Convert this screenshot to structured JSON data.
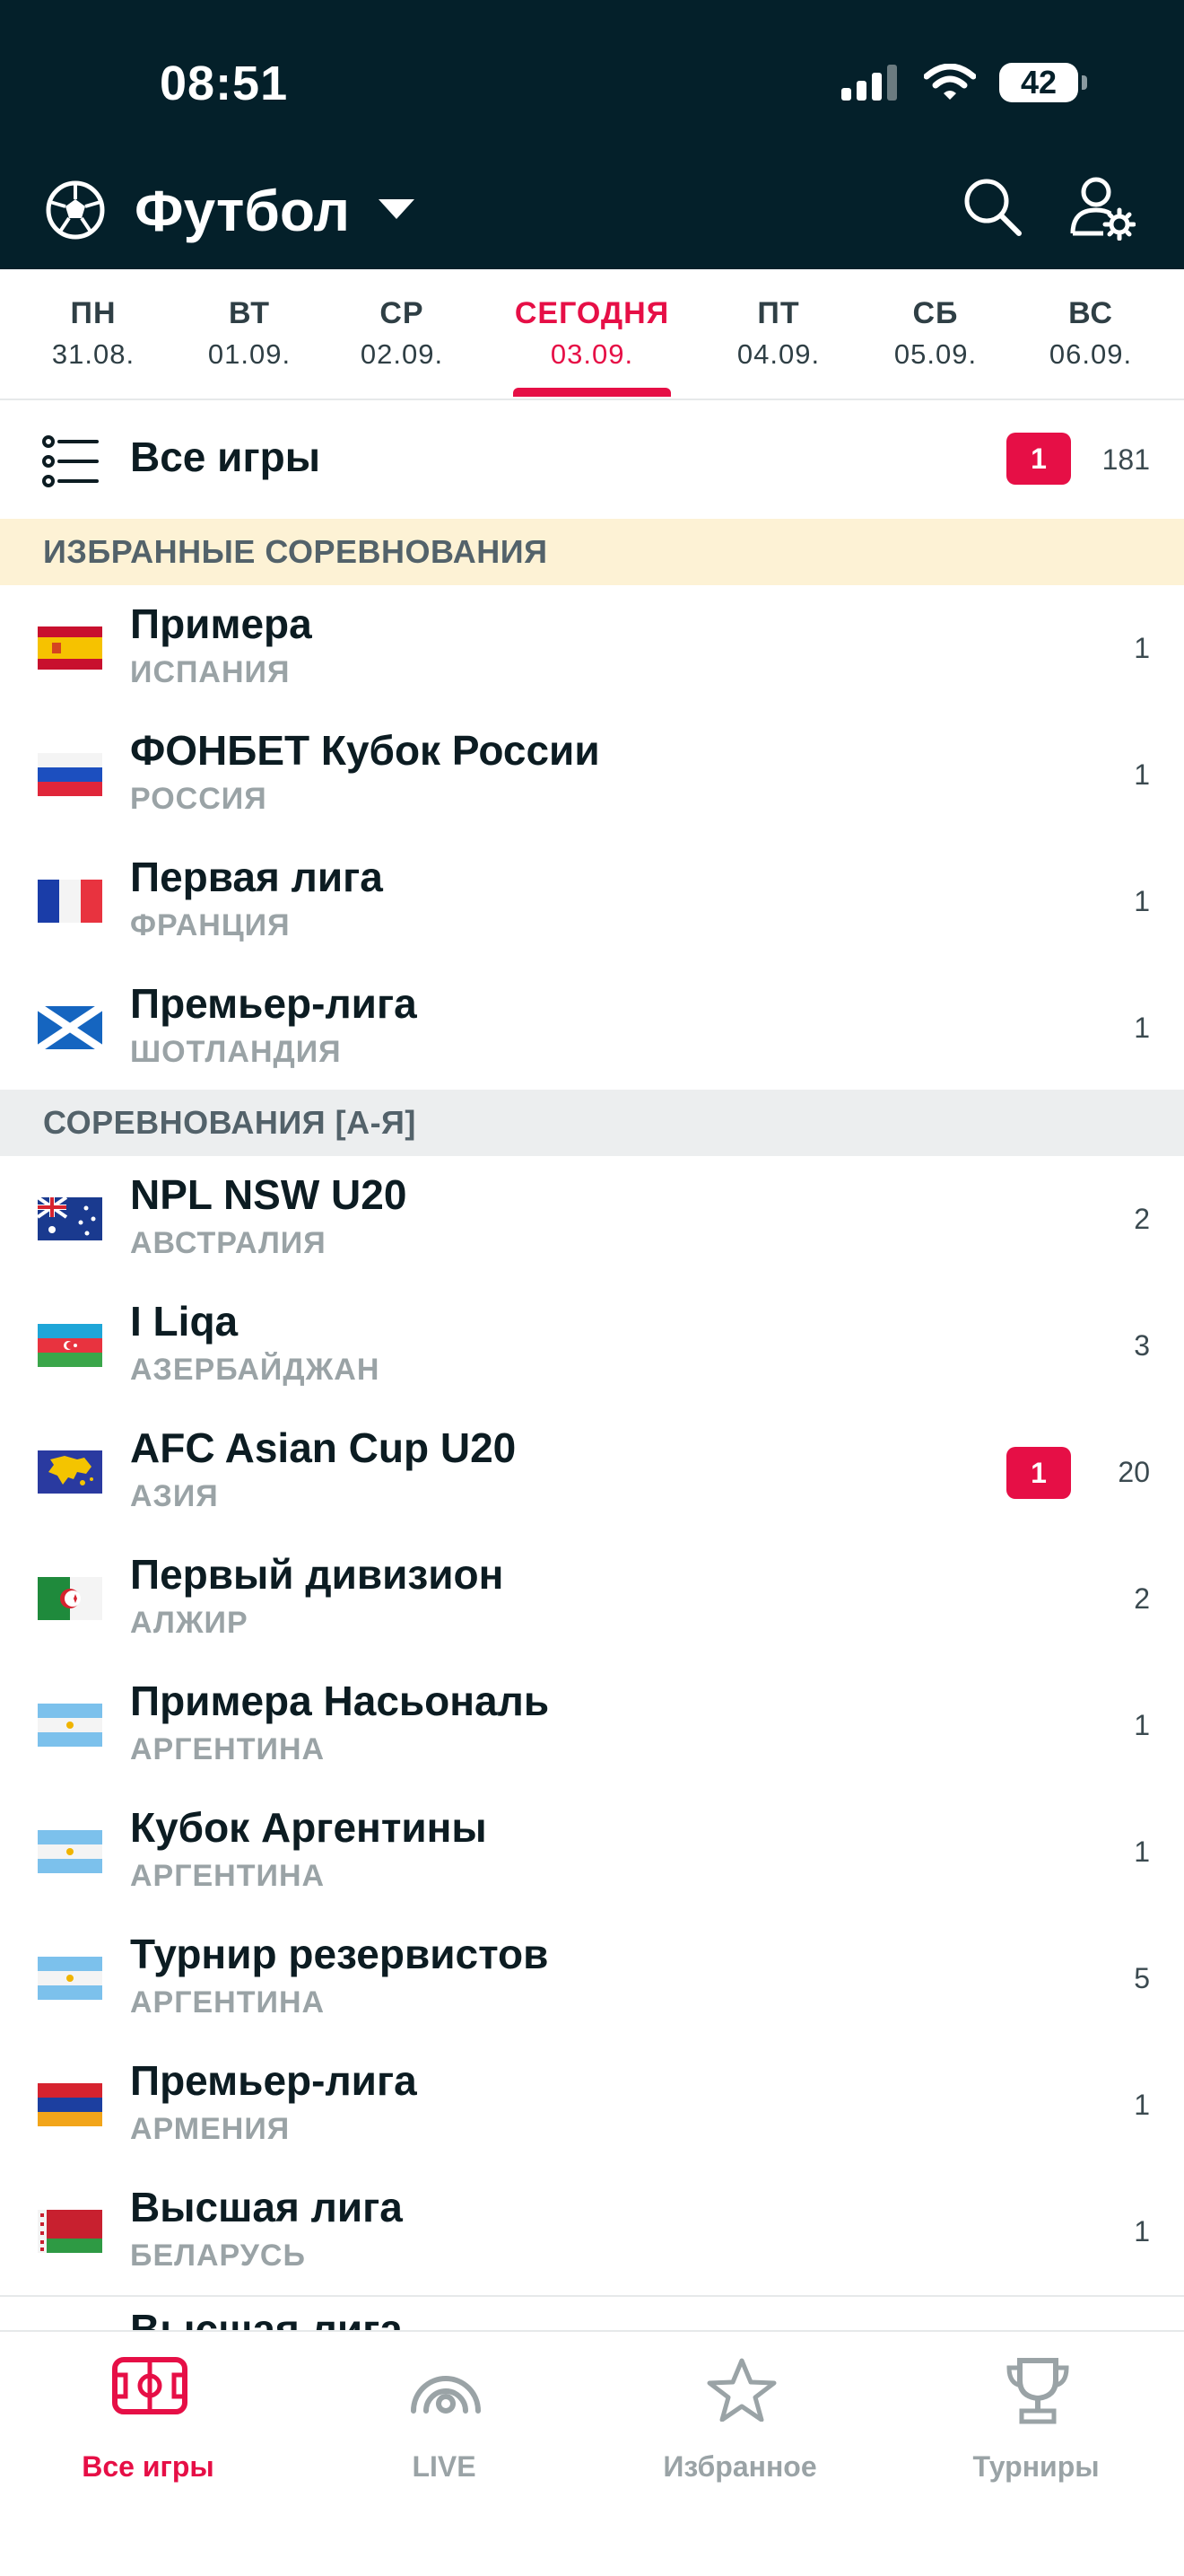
{
  "status_bar": {
    "time": "08:51",
    "battery": "42"
  },
  "app_bar": {
    "sport": "Футбол"
  },
  "days": [
    {
      "dow": "ПН",
      "date": "31.08."
    },
    {
      "dow": "ВТ",
      "date": "01.09."
    },
    {
      "dow": "СР",
      "date": "02.09."
    },
    {
      "dow": "СЕГОДНЯ",
      "date": "03.09.",
      "active": true
    },
    {
      "dow": "ПТ",
      "date": "04.09."
    },
    {
      "dow": "СБ",
      "date": "05.09."
    },
    {
      "dow": "ВС",
      "date": "06.09."
    }
  ],
  "all_games": {
    "label": "Все игры",
    "live": "1",
    "count": "181"
  },
  "sections": {
    "favorites": "ИЗБРАННЫЕ СОРЕВНОВАНИЯ",
    "all": "СОРЕВНОВАНИЯ [А-Я]"
  },
  "favorites": [
    {
      "name": "Примера",
      "country": "ИСПАНИЯ",
      "count": "1",
      "flag": "spain"
    },
    {
      "name": "ФОНБЕТ Кубок России",
      "country": "РОССИЯ",
      "count": "1",
      "flag": "russia"
    },
    {
      "name": "Первая лига",
      "country": "ФРАНЦИЯ",
      "count": "1",
      "flag": "france"
    },
    {
      "name": "Премьер-лига",
      "country": "ШОТЛАНДИЯ",
      "count": "1",
      "flag": "scotland"
    }
  ],
  "competitions": [
    {
      "name": "NPL NSW U20",
      "country": "АВСТРАЛИЯ",
      "count": "2",
      "flag": "australia"
    },
    {
      "name": "I Liqa",
      "country": "АЗЕРБАЙДЖАН",
      "count": "3",
      "flag": "azerbaijan"
    },
    {
      "name": "AFC Asian Cup U20",
      "country": "АЗИЯ",
      "count": "20",
      "live": "1",
      "flag": "asia"
    },
    {
      "name": "Первый дивизион",
      "country": "АЛЖИР",
      "count": "2",
      "flag": "algeria"
    },
    {
      "name": "Примера Насьональ",
      "country": "АРГЕНТИНА",
      "count": "1",
      "flag": "argentina"
    },
    {
      "name": "Кубок Аргентины",
      "country": "АРГЕНТИНА",
      "count": "1",
      "flag": "argentina"
    },
    {
      "name": "Турнир резервистов",
      "country": "АРГЕНТИНА",
      "count": "5",
      "flag": "argentina"
    },
    {
      "name": "Премьер-лига",
      "country": "АРМЕНИЯ",
      "count": "1",
      "flag": "armenia"
    },
    {
      "name": "Высшая лига",
      "country": "БЕЛАРУСЬ",
      "count": "1",
      "flag": "belarus"
    }
  ],
  "peek_row": "Высшая лига",
  "tabs": [
    {
      "label": "Все игры",
      "icon": "field-icon",
      "active": true
    },
    {
      "label": "LIVE",
      "icon": "live-icon"
    },
    {
      "label": "Избранное",
      "icon": "star-icon"
    },
    {
      "label": "Турниры",
      "icon": "trophy-icon"
    }
  ],
  "colors": {
    "header": "#04202a",
    "accent": "#e60f46",
    "favorites_bg": "#fdf2d5",
    "section_bg": "#eceeef"
  }
}
